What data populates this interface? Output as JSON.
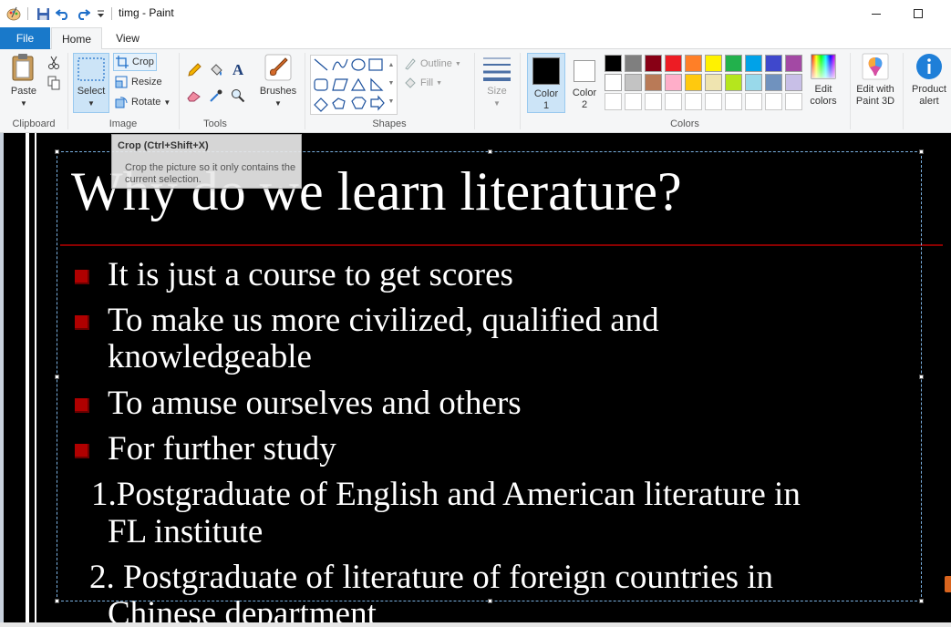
{
  "window": {
    "title": "timg - Paint",
    "minimize_label": "—",
    "maximize_label": "☐"
  },
  "tabs": [
    {
      "label": "File"
    },
    {
      "label": "Home"
    },
    {
      "label": "View"
    }
  ],
  "ribbon": {
    "clipboard": {
      "label": "Clipboard",
      "paste": "Paste"
    },
    "image": {
      "label": "Image",
      "select": "Select",
      "crop": "Crop",
      "resize": "Resize",
      "rotate": "Rotate"
    },
    "tools": {
      "label": "Tools"
    },
    "brushes": {
      "label": "Brushes"
    },
    "shapes": {
      "label": "Shapes",
      "outline": "Outline",
      "fill": "Fill"
    },
    "size": {
      "label": "Size"
    },
    "color1": {
      "line1": "Color",
      "line2": "1"
    },
    "color2": {
      "line1": "Color",
      "line2": "2"
    },
    "colors": {
      "label": "Colors"
    },
    "edit_colors": {
      "line1": "Edit",
      "line2": "colors"
    },
    "edit_paint3d": {
      "line1": "Edit with",
      "line2": "Paint 3D"
    },
    "product_alert": {
      "line1": "Product",
      "line2": "alert"
    }
  },
  "palette": {
    "row1": [
      "#000000",
      "#7f7f7f",
      "#880015",
      "#ed1c24",
      "#ff7f27",
      "#fff200",
      "#22b14c",
      "#00a2e8",
      "#3f48cc",
      "#a349a4"
    ],
    "row2": [
      "#ffffff",
      "#c3c3c3",
      "#b97a57",
      "#ffaec9",
      "#ffc90e",
      "#efe4b0",
      "#b5e61d",
      "#99d9ea",
      "#7092be",
      "#c8bfe7"
    ]
  },
  "tooltip": {
    "title": "Crop (Ctrl+Shift+X)",
    "body": "Crop the picture so it only contains the current selection."
  },
  "slide": {
    "title": "Why do we learn literature?",
    "bullets": [
      "It is just a course to get scores",
      "To make us more civilized, qualified   and",
      "knowledgeable",
      "To amuse ourselves and others",
      "For further study"
    ],
    "items": [
      "1.Postgraduate of English and American literature in",
      "FL institute",
      "2. Postgraduate of literature of foreign countries in",
      "Chinese department"
    ]
  }
}
